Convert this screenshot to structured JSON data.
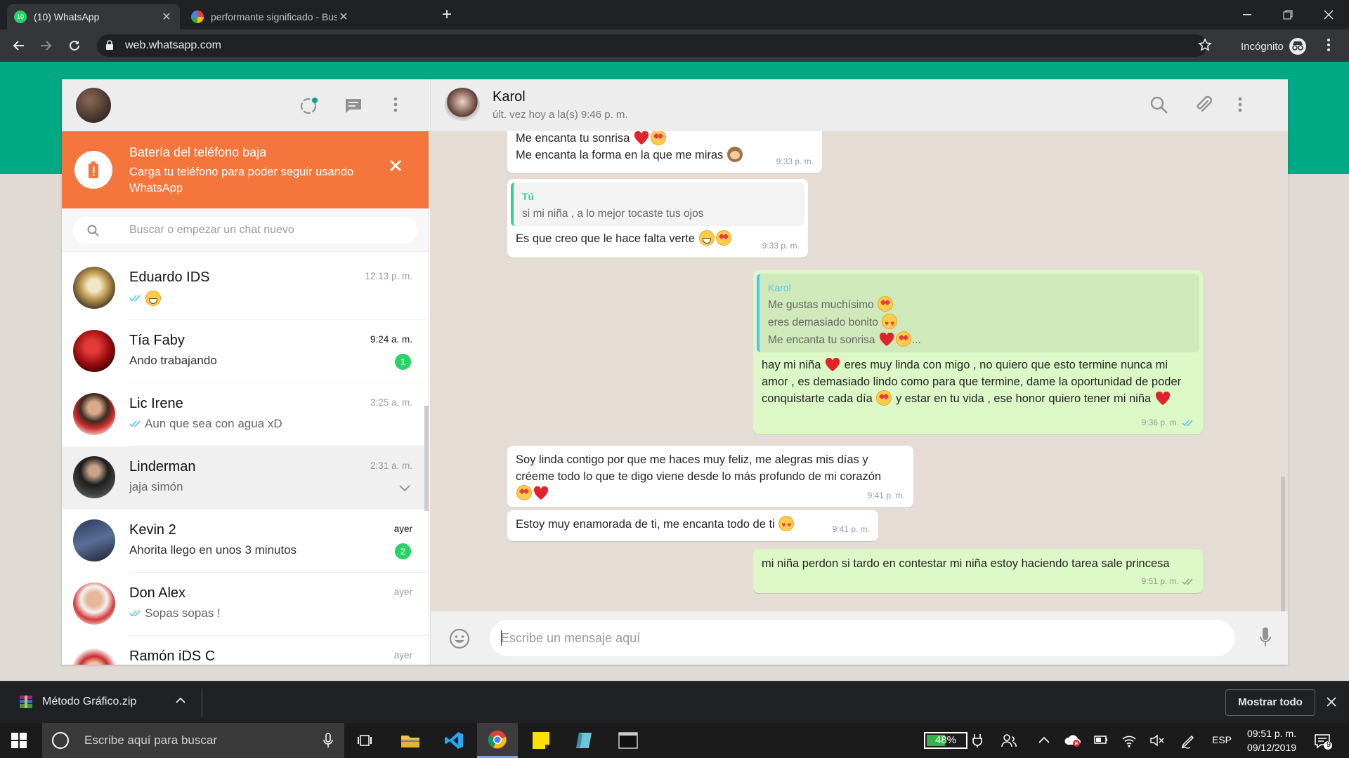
{
  "browser": {
    "tabs": [
      {
        "title": "(10) WhatsApp",
        "active": true,
        "favicon_badge": "10"
      },
      {
        "title": "performante significado - Buscar",
        "active": false
      }
    ],
    "url": "web.whatsapp.com",
    "profile_label": "Incógnito"
  },
  "sidebar": {
    "battery_alert": {
      "title": "Batería del teléfono baja",
      "body": "Carga tu teléfono para poder seguir usando WhatsApp"
    },
    "search_placeholder": "Buscar o empezar un chat nuevo",
    "chats": [
      {
        "name": "Eduardo IDS",
        "time": "12:13 p. m.",
        "preview": "",
        "ticks": true,
        "emoji": "grin"
      },
      {
        "name": "Tía Faby",
        "time": "9:24 a. m.",
        "preview": "Ando trabajando",
        "unread": "1"
      },
      {
        "name": "Lic Irene",
        "time": "3:25 a. m.",
        "preview": "Aun que sea con agua xD",
        "ticks": true
      },
      {
        "name": "Linderman",
        "time": "2:31 a. m.",
        "preview": "jaja simón",
        "selected": true
      },
      {
        "name": "Kevin 2",
        "time": "ayer",
        "preview": "Ahorita llego en unos 3 minutos",
        "unread": "2"
      },
      {
        "name": "Don Alex",
        "time": "ayer",
        "preview": "Sopas sopas !",
        "ticks": true
      },
      {
        "name": "Ramón iDS C",
        "time": "ayer",
        "preview": ""
      }
    ]
  },
  "conversation": {
    "contact_name": "Karol",
    "contact_status": "últ. vez hoy a la(s) 9:46 p. m.",
    "messages": {
      "m1": {
        "line1": "Me encanta tu sonrisa",
        "line2": "Me encanta la forma en la que me miras",
        "time": "9:33 p. m."
      },
      "m2": {
        "quote_name": "Tú",
        "quote_text": "si mi niña , a lo mejor tocaste tus ojos",
        "text": "Es que creo que le hace falta verte",
        "time": "9:33 p. m."
      },
      "m3": {
        "quote_name": "Karol",
        "quote_l1": "Me gustas muchísimo",
        "quote_l2": "eres demasiado bonito",
        "quote_l3": "Me encanta tu sonrisa",
        "quote_ellipsis": "...",
        "p1": "hay mi niña",
        "p2": "eres muy linda con migo , no quiero que esto termine nunca mi amor , es demasiado lindo como para que termine, dame la oportunidad de poder conquistarte cada día",
        "p3": "y estar en tu vida , ese honor quiero tener mi niña",
        "time": "9:36 p. m."
      },
      "m4": {
        "text": "Soy linda contigo por que me haces muy feliz, me alegras mis días y créeme todo lo que te digo viene desde lo más profundo de mi corazón",
        "time": "9:41 p. m."
      },
      "m5": {
        "text": "Estoy muy enamorada de ti, me encanta todo de ti",
        "time": "9:41 p. m."
      },
      "m6": {
        "text": "mi niña perdon si tardo en contestar mi niña estoy haciendo tarea sale princesa",
        "time": "9:51 p. m."
      }
    },
    "input_placeholder": "Escribe un mensaje aquí"
  },
  "downloads": {
    "file_name": "Método Gráfico.zip",
    "show_all": "Mostrar todo"
  },
  "taskbar": {
    "search_placeholder": "Escribe aquí para buscar",
    "battery_percent": "48%",
    "language": "ESP",
    "time": "09:51 p. m.",
    "date": "09/12/2019",
    "notifications": "9"
  },
  "colors": {
    "whatsapp_green": "#00a884",
    "alert_orange": "#f4763c",
    "outgoing_bubble": "#dcf8c6",
    "unread_badge": "#25d366",
    "tick_blue": "#4fc3f7"
  }
}
